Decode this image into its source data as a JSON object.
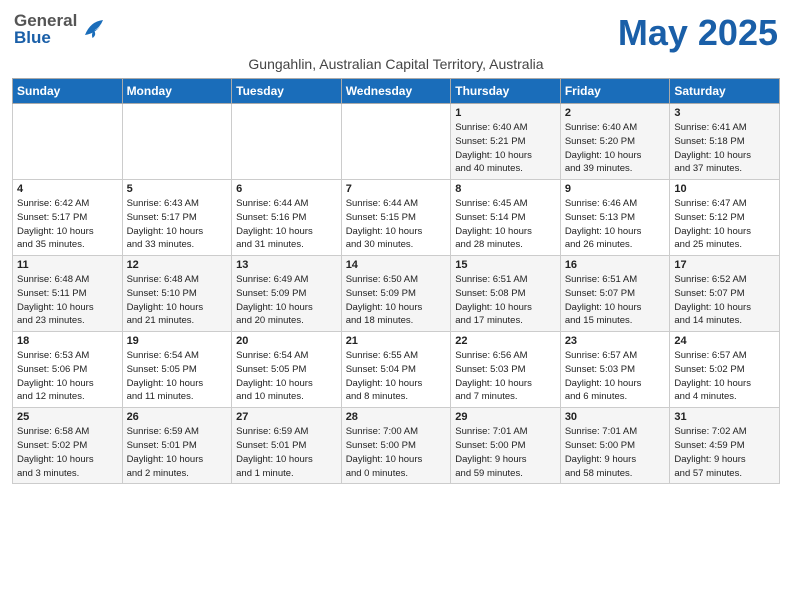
{
  "header": {
    "logo_general": "General",
    "logo_blue": "Blue",
    "month_title": "May 2025",
    "location": "Gungahlin, Australian Capital Territory, Australia"
  },
  "days_of_week": [
    "Sunday",
    "Monday",
    "Tuesday",
    "Wednesday",
    "Thursday",
    "Friday",
    "Saturday"
  ],
  "weeks": [
    [
      {
        "num": "",
        "detail": ""
      },
      {
        "num": "",
        "detail": ""
      },
      {
        "num": "",
        "detail": ""
      },
      {
        "num": "",
        "detail": ""
      },
      {
        "num": "1",
        "detail": "Sunrise: 6:40 AM\nSunset: 5:21 PM\nDaylight: 10 hours\nand 40 minutes."
      },
      {
        "num": "2",
        "detail": "Sunrise: 6:40 AM\nSunset: 5:20 PM\nDaylight: 10 hours\nand 39 minutes."
      },
      {
        "num": "3",
        "detail": "Sunrise: 6:41 AM\nSunset: 5:18 PM\nDaylight: 10 hours\nand 37 minutes."
      }
    ],
    [
      {
        "num": "4",
        "detail": "Sunrise: 6:42 AM\nSunset: 5:17 PM\nDaylight: 10 hours\nand 35 minutes."
      },
      {
        "num": "5",
        "detail": "Sunrise: 6:43 AM\nSunset: 5:17 PM\nDaylight: 10 hours\nand 33 minutes."
      },
      {
        "num": "6",
        "detail": "Sunrise: 6:44 AM\nSunset: 5:16 PM\nDaylight: 10 hours\nand 31 minutes."
      },
      {
        "num": "7",
        "detail": "Sunrise: 6:44 AM\nSunset: 5:15 PM\nDaylight: 10 hours\nand 30 minutes."
      },
      {
        "num": "8",
        "detail": "Sunrise: 6:45 AM\nSunset: 5:14 PM\nDaylight: 10 hours\nand 28 minutes."
      },
      {
        "num": "9",
        "detail": "Sunrise: 6:46 AM\nSunset: 5:13 PM\nDaylight: 10 hours\nand 26 minutes."
      },
      {
        "num": "10",
        "detail": "Sunrise: 6:47 AM\nSunset: 5:12 PM\nDaylight: 10 hours\nand 25 minutes."
      }
    ],
    [
      {
        "num": "11",
        "detail": "Sunrise: 6:48 AM\nSunset: 5:11 PM\nDaylight: 10 hours\nand 23 minutes."
      },
      {
        "num": "12",
        "detail": "Sunrise: 6:48 AM\nSunset: 5:10 PM\nDaylight: 10 hours\nand 21 minutes."
      },
      {
        "num": "13",
        "detail": "Sunrise: 6:49 AM\nSunset: 5:09 PM\nDaylight: 10 hours\nand 20 minutes."
      },
      {
        "num": "14",
        "detail": "Sunrise: 6:50 AM\nSunset: 5:09 PM\nDaylight: 10 hours\nand 18 minutes."
      },
      {
        "num": "15",
        "detail": "Sunrise: 6:51 AM\nSunset: 5:08 PM\nDaylight: 10 hours\nand 17 minutes."
      },
      {
        "num": "16",
        "detail": "Sunrise: 6:51 AM\nSunset: 5:07 PM\nDaylight: 10 hours\nand 15 minutes."
      },
      {
        "num": "17",
        "detail": "Sunrise: 6:52 AM\nSunset: 5:07 PM\nDaylight: 10 hours\nand 14 minutes."
      }
    ],
    [
      {
        "num": "18",
        "detail": "Sunrise: 6:53 AM\nSunset: 5:06 PM\nDaylight: 10 hours\nand 12 minutes."
      },
      {
        "num": "19",
        "detail": "Sunrise: 6:54 AM\nSunset: 5:05 PM\nDaylight: 10 hours\nand 11 minutes."
      },
      {
        "num": "20",
        "detail": "Sunrise: 6:54 AM\nSunset: 5:05 PM\nDaylight: 10 hours\nand 10 minutes."
      },
      {
        "num": "21",
        "detail": "Sunrise: 6:55 AM\nSunset: 5:04 PM\nDaylight: 10 hours\nand 8 minutes."
      },
      {
        "num": "22",
        "detail": "Sunrise: 6:56 AM\nSunset: 5:03 PM\nDaylight: 10 hours\nand 7 minutes."
      },
      {
        "num": "23",
        "detail": "Sunrise: 6:57 AM\nSunset: 5:03 PM\nDaylight: 10 hours\nand 6 minutes."
      },
      {
        "num": "24",
        "detail": "Sunrise: 6:57 AM\nSunset: 5:02 PM\nDaylight: 10 hours\nand 4 minutes."
      }
    ],
    [
      {
        "num": "25",
        "detail": "Sunrise: 6:58 AM\nSunset: 5:02 PM\nDaylight: 10 hours\nand 3 minutes."
      },
      {
        "num": "26",
        "detail": "Sunrise: 6:59 AM\nSunset: 5:01 PM\nDaylight: 10 hours\nand 2 minutes."
      },
      {
        "num": "27",
        "detail": "Sunrise: 6:59 AM\nSunset: 5:01 PM\nDaylight: 10 hours\nand 1 minute."
      },
      {
        "num": "28",
        "detail": "Sunrise: 7:00 AM\nSunset: 5:00 PM\nDaylight: 10 hours\nand 0 minutes."
      },
      {
        "num": "29",
        "detail": "Sunrise: 7:01 AM\nSunset: 5:00 PM\nDaylight: 9 hours\nand 59 minutes."
      },
      {
        "num": "30",
        "detail": "Sunrise: 7:01 AM\nSunset: 5:00 PM\nDaylight: 9 hours\nand 58 minutes."
      },
      {
        "num": "31",
        "detail": "Sunrise: 7:02 AM\nSunset: 4:59 PM\nDaylight: 9 hours\nand 57 minutes."
      }
    ]
  ]
}
